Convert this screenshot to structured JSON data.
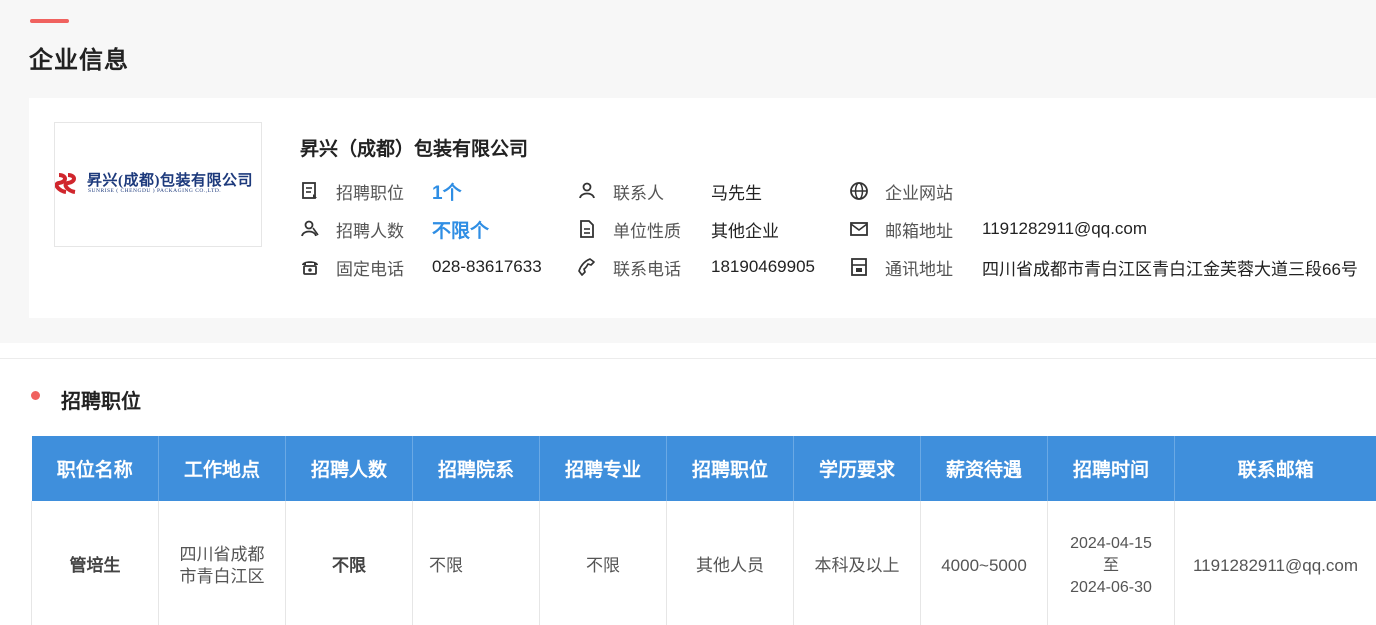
{
  "page": {
    "title": "企业信息"
  },
  "company": {
    "logo_text_cn": "昇兴(成都)包装有限公司",
    "logo_text_en": "SUNRISE ( CHENGDU ) PACKAGING CO.,LTD.",
    "name": "昇兴（成都）包装有限公司",
    "fields": {
      "positions": {
        "label": "招聘职位",
        "value": "1个",
        "icon": "document-list-icon"
      },
      "headcount": {
        "label": "招聘人数",
        "value": "不限个",
        "icon": "users-icon"
      },
      "landline": {
        "label": "固定电话",
        "value": "028-83617633",
        "icon": "telephone-icon"
      },
      "contact": {
        "label": "联系人",
        "value": "马先生",
        "icon": "user-icon"
      },
      "nature": {
        "label": "单位性质",
        "value": "其他企业",
        "icon": "document-icon"
      },
      "phone": {
        "label": "联系电话",
        "value": "18190469905",
        "icon": "phone-handset-icon"
      },
      "website": {
        "label": "企业网站",
        "value": "",
        "icon": "globe-icon"
      },
      "email": {
        "label": "邮箱地址",
        "value": "1191282911@qq.com",
        "icon": "mail-icon"
      },
      "address": {
        "label": "通讯地址",
        "value": "四川省成都市青白江区青白江金芙蓉大道三段66号",
        "icon": "building-icon"
      }
    }
  },
  "jobs_section": {
    "title": "招聘职位",
    "columns": [
      "职位名称",
      "工作地点",
      "招聘人数",
      "招聘院系",
      "招聘专业",
      "招聘职位",
      "学历要求",
      "薪资待遇",
      "招聘时间",
      "联系邮箱"
    ],
    "rows": [
      {
        "title": "管培生",
        "location": "四川省成都市青白江区",
        "headcount": "不限",
        "department": "不限",
        "major": "不限",
        "position": "其他人员",
        "education": "本科及以上",
        "salary": "4000~5000",
        "time_start": "2024-04-15",
        "time_sep": "至",
        "time_end": "2024-06-30",
        "email": "1191282911@qq.com"
      }
    ]
  },
  "colors": {
    "accent": "#f0625f",
    "header_blue": "#3f8fdc",
    "value_blue": "#2f8ee4"
  }
}
